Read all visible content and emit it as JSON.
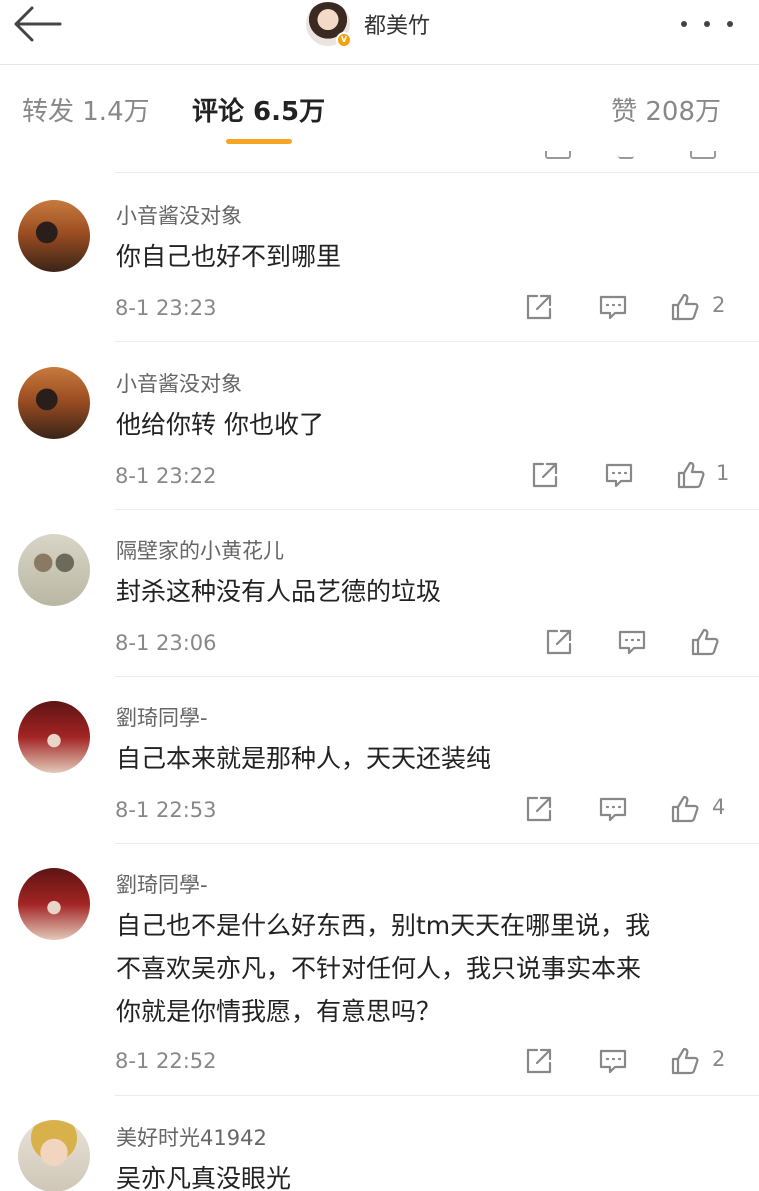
{
  "header": {
    "author_name": "都美竹",
    "verified_badge": "V",
    "icons": {
      "back": "back-arrow-icon",
      "more": "more-dots-icon"
    }
  },
  "tabs": [
    {
      "label": "转发 1.4万",
      "active": false
    },
    {
      "label": "评论 6.5万",
      "active": true
    },
    {
      "label": "赞 208万",
      "active": false
    }
  ],
  "colors": {
    "accent": "#f6a623",
    "text_primary": "#222222",
    "text_secondary": "#888888"
  },
  "comments": [
    {
      "username": "小音酱没对象",
      "text": [
        "你自己也好不到哪里"
      ],
      "time": "8-1 23:23",
      "likes": "2"
    },
    {
      "username": "小音酱没对象",
      "text": [
        "他给你转 你也收了"
      ],
      "time": "8-1 23:22",
      "likes": "1"
    },
    {
      "username": "隔壁家的小黄花儿",
      "text": [
        "封杀这种没有人品艺德的垃圾"
      ],
      "time": "8-1 23:06",
      "likes": ""
    },
    {
      "username": "劉琦同學-",
      "text": [
        "自己本来就是那种人，天天还装纯"
      ],
      "time": "8-1 22:53",
      "likes": "4"
    },
    {
      "username": "劉琦同學-",
      "text": [
        "自己也不是什么好东西，别tm天天在哪里说，我",
        "不喜欢吴亦凡，不针对任何人，我只说事实本来",
        "你就是你情我愿，有意思吗？"
      ],
      "time": "8-1 22:52",
      "likes": "2"
    },
    {
      "username": "美好时光41942",
      "text": [
        "吴亦凡真没眼光"
      ],
      "time": "",
      "likes": ""
    }
  ]
}
